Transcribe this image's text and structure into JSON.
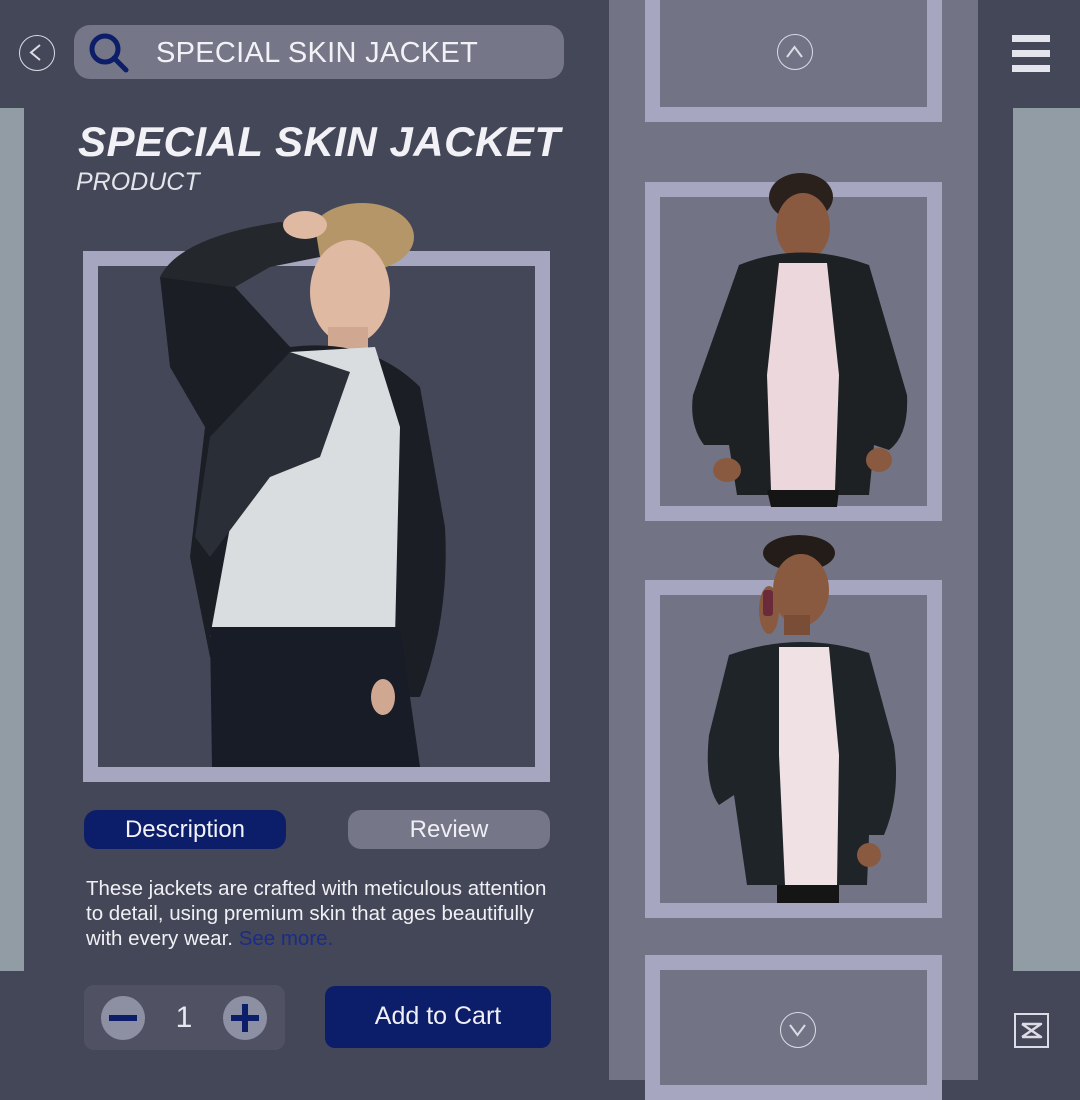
{
  "search": {
    "query": "SPECIAL SKIN JACKET",
    "icon": "search-icon"
  },
  "product": {
    "title": "SPECIAL SKIN JACKET",
    "subtitle": "PRODUCT"
  },
  "tabs": [
    {
      "label": "Description",
      "active": true
    },
    {
      "label": "Review",
      "active": false
    }
  ],
  "description": {
    "text": "These jackets are crafted with meticulous attention to detail, using premium skin that ages beautifully with every wear.",
    "see_more": "See more."
  },
  "quantity": {
    "value": "1"
  },
  "cart": {
    "label": "Add to Cart"
  },
  "colors": {
    "background": "#444758",
    "accent": "#0c1d6a",
    "frame": "#a7a6c0",
    "panel": "#727486"
  }
}
